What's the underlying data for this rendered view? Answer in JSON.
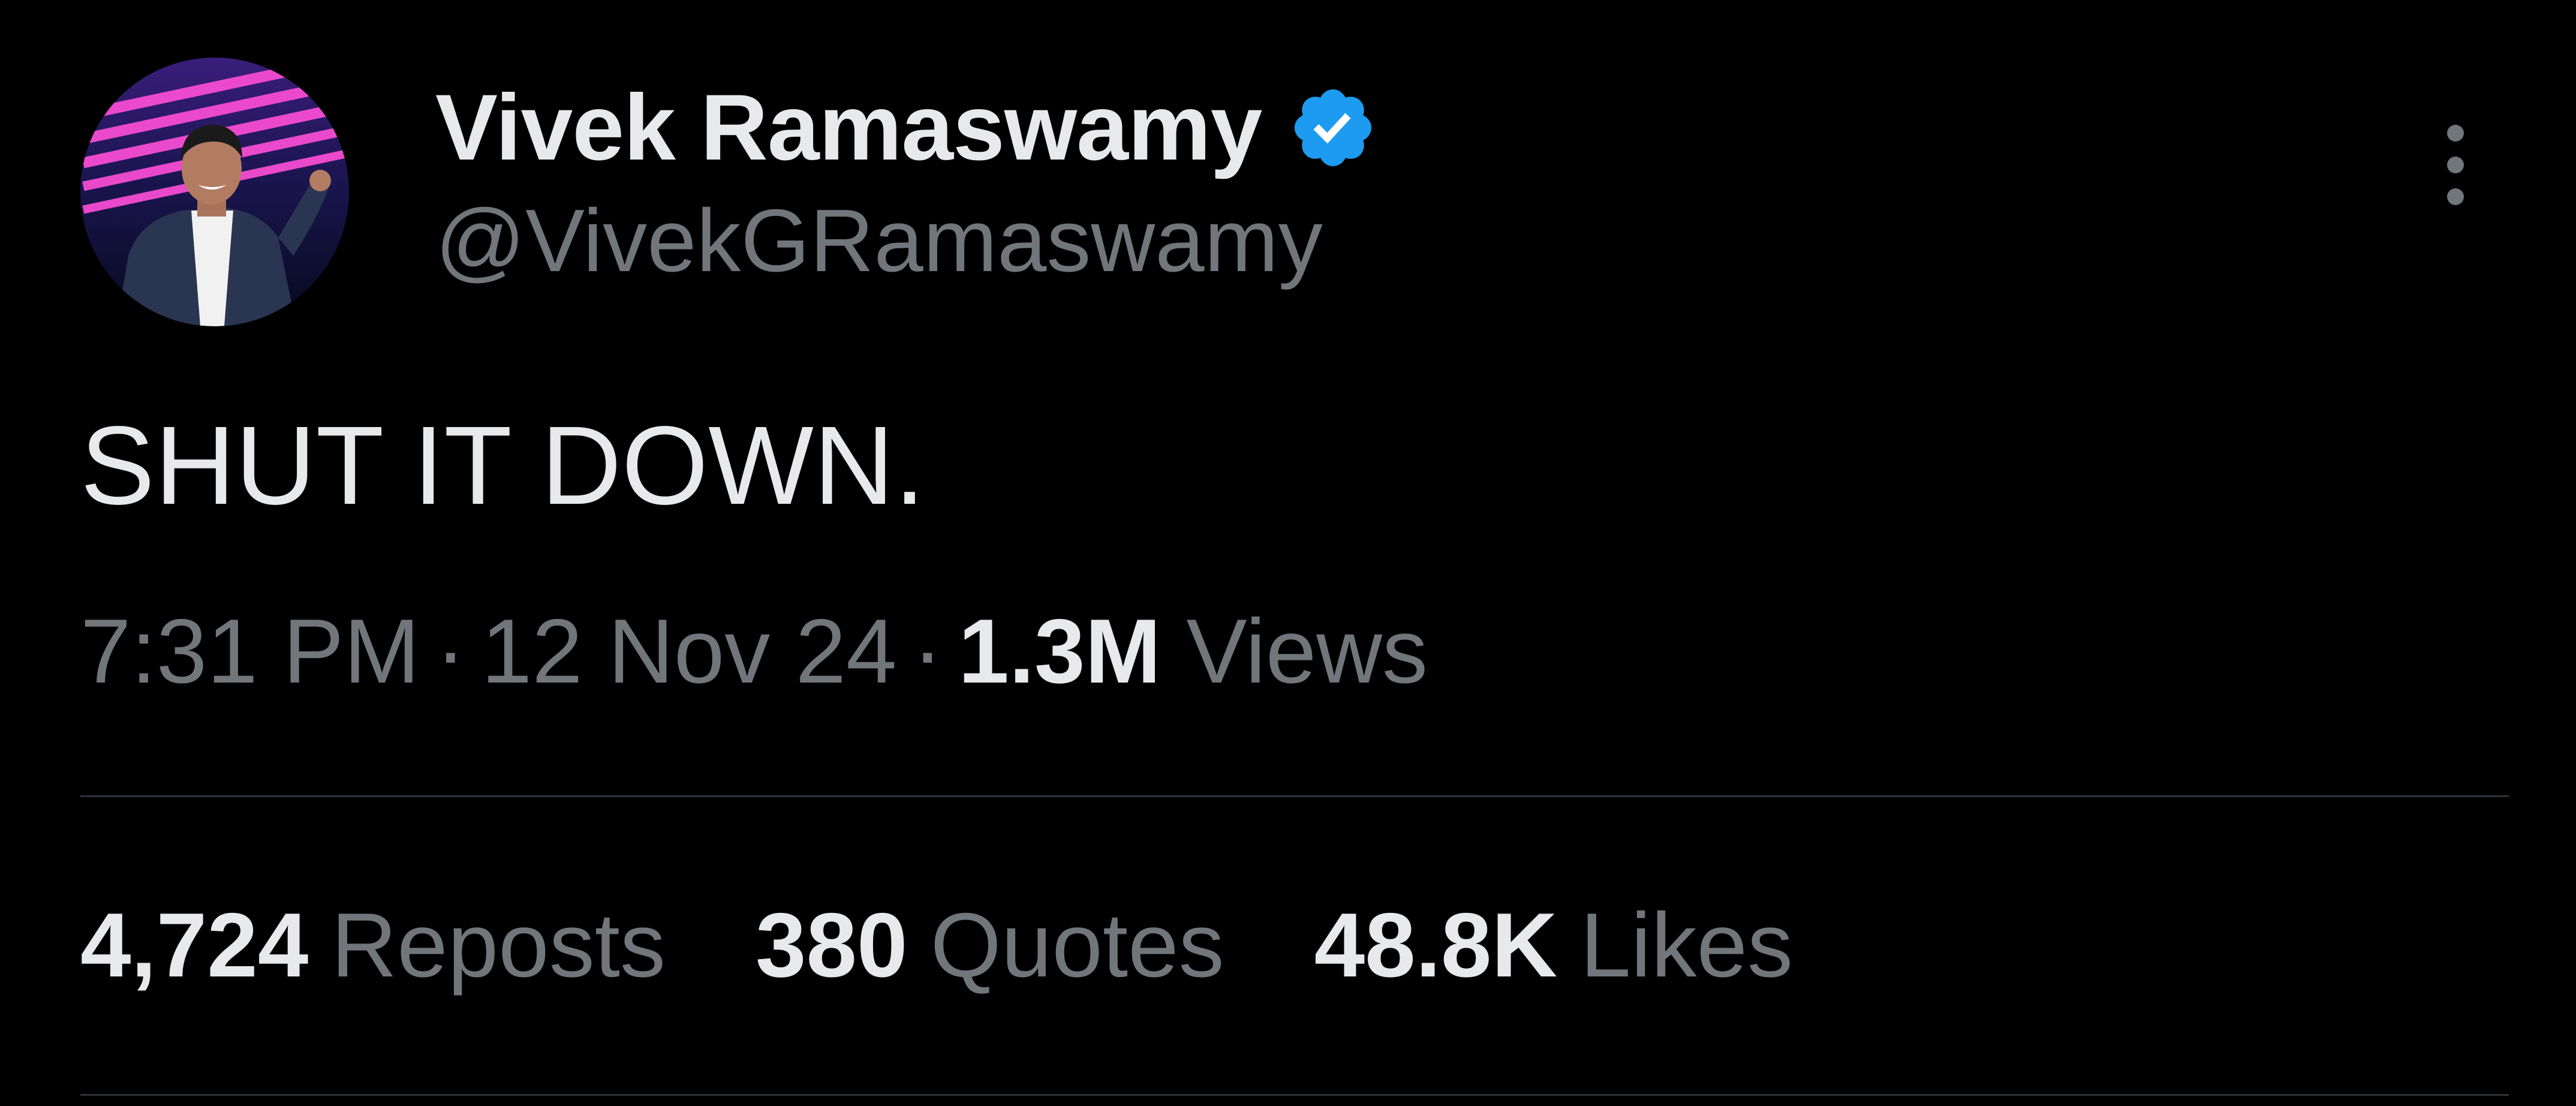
{
  "author": {
    "display_name": "Vivek Ramaswamy",
    "handle": "@VivekGRamaswamy",
    "verified": true,
    "verified_color": "#1d9bf0"
  },
  "icons": {
    "avatar": "profile-photo",
    "verified": "verified-badge-icon",
    "more": "more-options-vertical-icon"
  },
  "tweet": {
    "text": "SHUT IT DOWN."
  },
  "meta": {
    "time": "7:31 PM",
    "separator": "·",
    "date": "12 Nov 24",
    "views_count": "1.3M",
    "views_label": "Views"
  },
  "stats": [
    {
      "count": "4,724",
      "label": "Reposts"
    },
    {
      "count": "380",
      "label": "Quotes"
    },
    {
      "count": "48.8K",
      "label": "Likes"
    }
  ],
  "colors": {
    "background": "#000000",
    "primary_text": "#e7e9ea",
    "secondary_text": "#71767b",
    "divider": "#2f3336"
  }
}
